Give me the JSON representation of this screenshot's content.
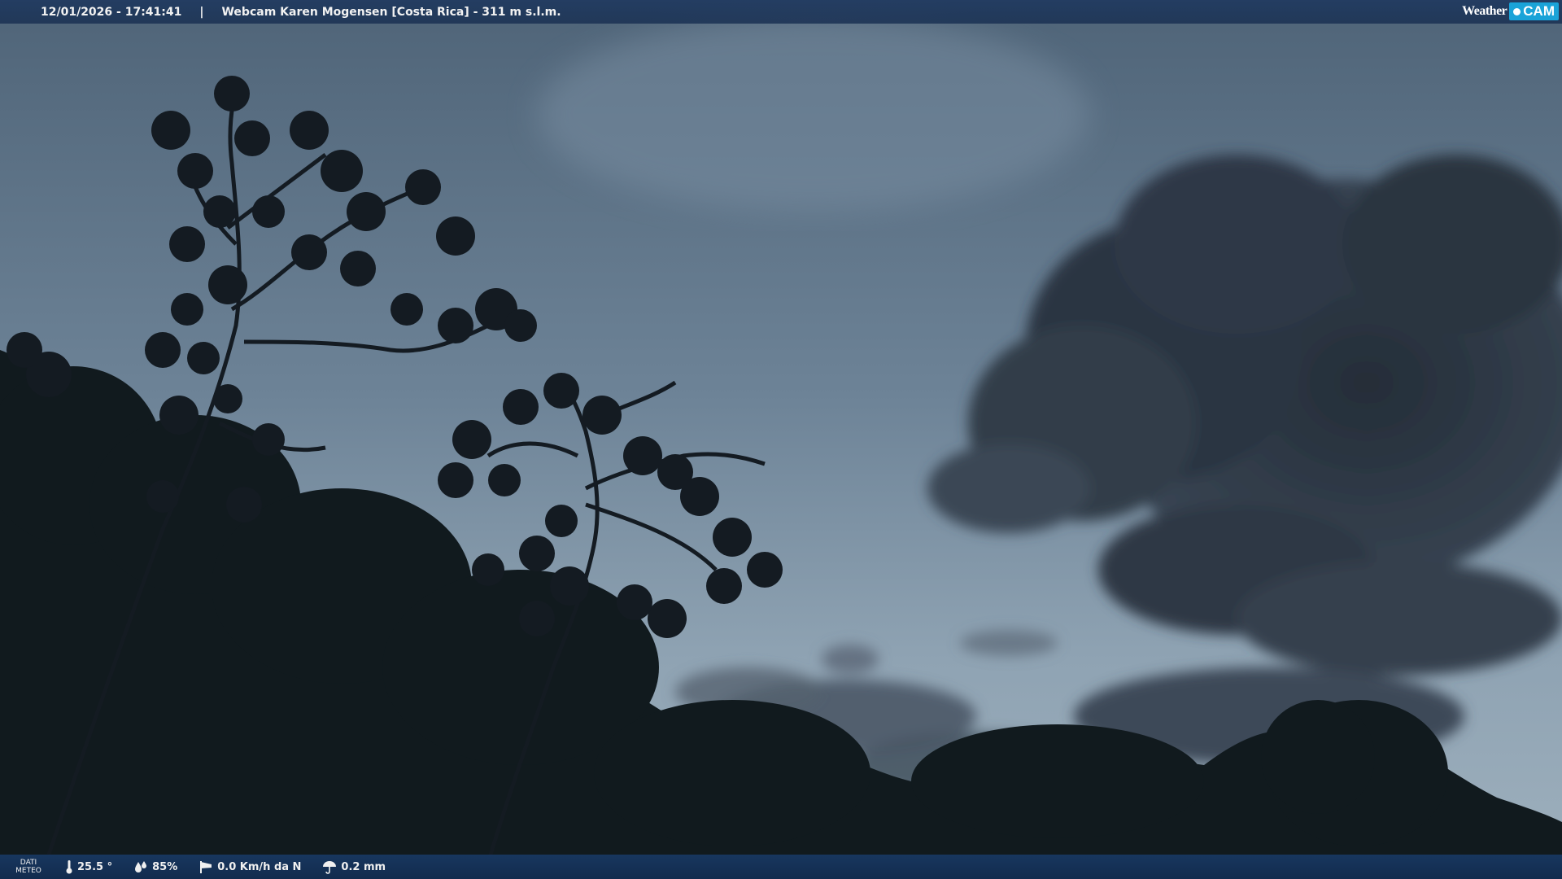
{
  "overlay": {
    "timestamp": "12/01/2026 - 17:41:41",
    "separator": "|",
    "title": "Webcam Karen Mogensen [Costa Rica]  - 311 m s.l.m.",
    "logo_weather": "Weather",
    "logo_cam": "CAM"
  },
  "weather_bar": {
    "label_line1": "DATI",
    "label_line2": "METEO",
    "temperature": "25.5 °",
    "humidity": "85%",
    "wind": "0.0 Km/h da N",
    "rain": "0.2 mm"
  },
  "icons": {
    "temperature": "thermometer-icon",
    "humidity": "water-drops-icon",
    "wind": "windsock-icon",
    "rain": "rain-umbrella-icon"
  },
  "colors": {
    "bar_background": "#1c3a66",
    "logo_accent": "#1aa3d8"
  }
}
